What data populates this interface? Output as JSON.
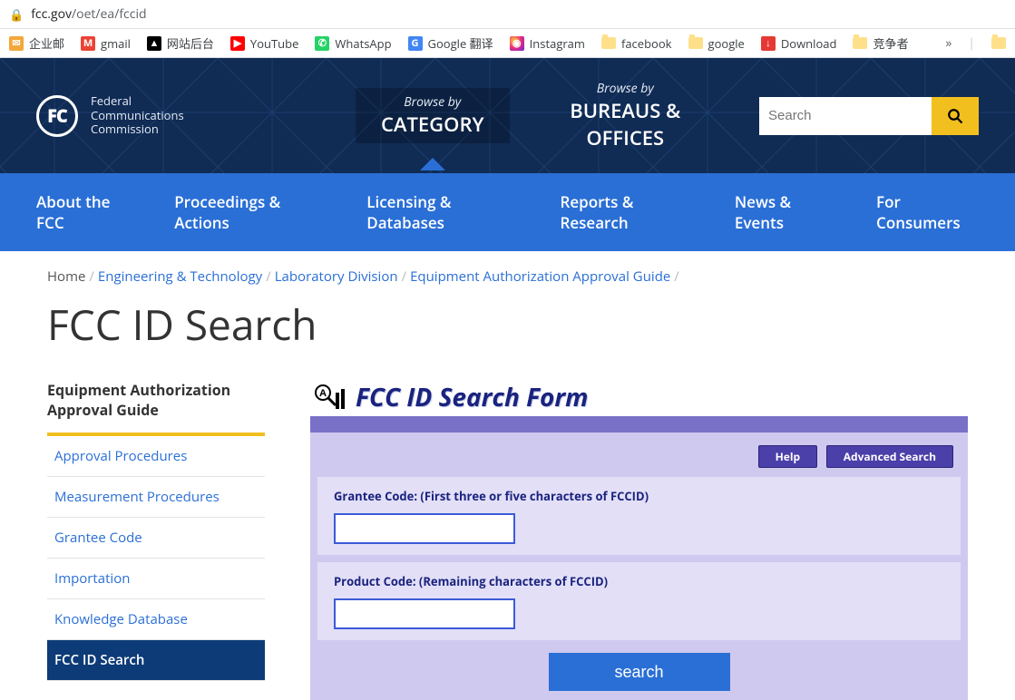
{
  "address": {
    "host": "fcc.gov",
    "path": "/oet/ea/fccid"
  },
  "bookmarks": [
    {
      "label": "企业邮",
      "bg": "#f2a73b",
      "glyph": "✉"
    },
    {
      "label": "gmail",
      "bg": "#ea4335",
      "glyph": "M"
    },
    {
      "label": "网站后台",
      "bg": "#000000",
      "glyph": "▲"
    },
    {
      "label": "YouTube",
      "bg": "#ff0000",
      "glyph": "▶"
    },
    {
      "label": "WhatsApp",
      "bg": "#25d366",
      "glyph": "✆"
    },
    {
      "label": "Google 翻译",
      "bg": "#4285f4",
      "glyph": "G"
    },
    {
      "label": "Instagram",
      "bg": "linear",
      "glyph": "◉"
    },
    {
      "label": "facebook",
      "bg": "folder",
      "glyph": ""
    },
    {
      "label": "google",
      "bg": "folder",
      "glyph": ""
    },
    {
      "label": "Download",
      "bg": "#e53935",
      "glyph": "↓"
    },
    {
      "label": "竞争者",
      "bg": "folder",
      "glyph": ""
    }
  ],
  "overflow": "»",
  "logo": {
    "lines": [
      "Federal",
      "Communications",
      "Commission"
    ]
  },
  "browse": {
    "by": "Browse by",
    "category": "CATEGORY",
    "bureaus": "BUREAUS & OFFICES"
  },
  "search": {
    "placeholder": "Search"
  },
  "nav2": [
    "About the FCC",
    "Proceedings & Actions",
    "Licensing & Databases",
    "Reports & Research",
    "News & Events",
    "For Consumers"
  ],
  "breadcrumbs": [
    "Home",
    "Engineering & Technology",
    "Laboratory Division",
    "Equipment Authorization Approval Guide"
  ],
  "page_title": "FCC ID Search",
  "sidebar": {
    "heading": "Equipment Authorization Approval Guide",
    "items": [
      "Approval Procedures",
      "Measurement Procedures",
      "Grantee Code",
      "Importation",
      "Knowledge Database",
      "FCC ID Search"
    ],
    "active_index": 5
  },
  "form": {
    "title": "FCC ID Search Form",
    "help_label": "Help",
    "advanced_label": "Advanced Search",
    "grantee_label": "Grantee Code: (First three or five characters of FCCID)",
    "product_label": "Product Code: (Remaining characters of FCCID)",
    "search_label": "search"
  }
}
